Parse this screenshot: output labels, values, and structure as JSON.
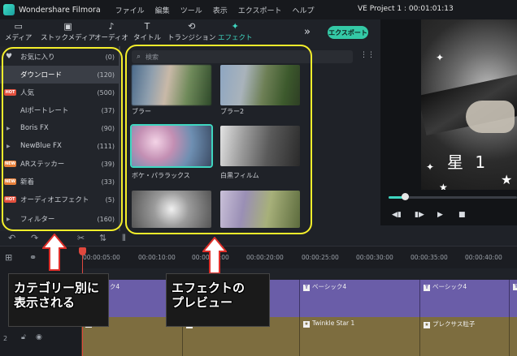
{
  "titlebar": {
    "app_name": "Wondershare Filmora",
    "menu": [
      "ファイル",
      "編集",
      "ツール",
      "表示",
      "エクスポート",
      "ヘルプ"
    ],
    "project": "VE Project 1 : 00:01:01:13"
  },
  "toolbar": {
    "tabs": [
      {
        "label": "メディア",
        "icon": "folder-icon"
      },
      {
        "label": "ストックメディア",
        "icon": "stock-media-icon"
      },
      {
        "label": "オーディオ",
        "icon": "music-note-icon"
      },
      {
        "label": "タイトル",
        "icon": "title-t-icon"
      },
      {
        "label": "トランジション",
        "icon": "transition-icon"
      },
      {
        "label": "エフェクト",
        "icon": "effects-icon"
      }
    ],
    "active_tab": "エフェクト",
    "export_label": "エクスポート",
    "more_symbol": "»"
  },
  "sidebar": {
    "items": [
      {
        "label": "お気に入り",
        "count": "(0)",
        "marker": "heart"
      },
      {
        "label": "ダウンロード",
        "count": "(120)",
        "marker": "",
        "selected": true
      },
      {
        "label": "人気",
        "count": "(500)",
        "marker": "HOT"
      },
      {
        "label": "AIポートレート",
        "count": "(37)",
        "marker": ""
      },
      {
        "label": "Boris FX",
        "count": "(90)",
        "marker": "triangle"
      },
      {
        "label": "NewBlue FX",
        "count": "(111)",
        "marker": "triangle"
      },
      {
        "label": "ARステッカー",
        "count": "(39)",
        "marker": "NEW"
      },
      {
        "label": "新着",
        "count": "(33)",
        "marker": "NEW"
      },
      {
        "label": "オーディオエフェクト",
        "count": "(5)",
        "marker": "HOT"
      },
      {
        "label": "フィルター",
        "count": "(160)",
        "marker": "triangle"
      }
    ]
  },
  "content": {
    "search_placeholder": "検索",
    "effects": [
      {
        "label": "ブラー"
      },
      {
        "label": "ブラー2"
      },
      {
        "label": "ボケ・パララックス"
      },
      {
        "label": "白黒フィルム"
      },
      {
        "label": ""
      },
      {
        "label": ""
      }
    ]
  },
  "preview": {
    "overlay_text": "星 1",
    "progress": 0.12
  },
  "timeline": {
    "ticks": [
      "00:00:05:00",
      "00:00:10:00",
      "00:00:15:00",
      "00:00:20:00",
      "00:00:25:00",
      "00:00:30:00",
      "00:00:35:00",
      "00:00:40:00"
    ],
    "track1_clips": [
      "ベーシック4",
      "ベーシック4",
      "ベーシック4",
      ""
    ],
    "track2_clips": [
      "",
      "星 1",
      "Twinkle Star 1",
      "プレクサス粒子"
    ],
    "track2_label": "2"
  },
  "annotations": {
    "left_callout": [
      "カテゴリー別に",
      "表示される"
    ],
    "right_callout": [
      "エフェクトの",
      "プレビュー"
    ],
    "box_color": "#f5ef2b",
    "arrow_color": "#e0302a"
  }
}
